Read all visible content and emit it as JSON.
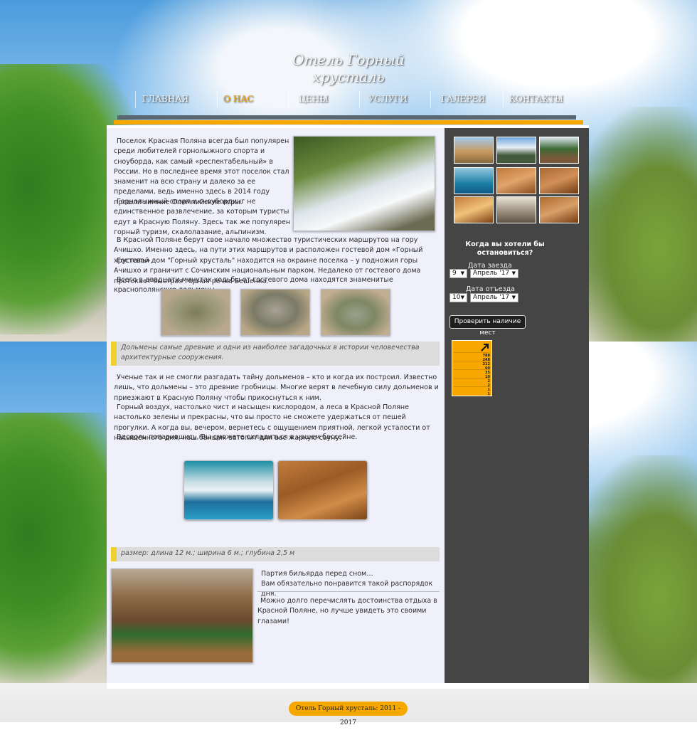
{
  "site": {
    "logo_text": "Отель Горный хрусталь"
  },
  "nav": {
    "items": [
      {
        "label": "ГЛАВНАЯ"
      },
      {
        "label": "О НАС"
      },
      {
        "label": "ЦЕНЫ"
      },
      {
        "label": "УСЛУГИ"
      },
      {
        "label": "ГАЛЕРЕЯ"
      },
      {
        "label": "КОНТАКТЫ"
      }
    ],
    "active_index": 1
  },
  "main": {
    "intro": [
      "Поселок Красная Поляна всегда был популярен среди любителей горнолыжного спорта и сноуборда, как самый «респектабельный» в России. Но в последнее время этот поселок стал знаменит на всю страну и далеко за ее пределами, ведь именно здесь в 2014 году прошли зимние Олимпийские игры.",
      "Горнолыжный спорт и сноубординг не единственное развлечение, за которым туристы едут в Красную Поляну. Здесь так же популярен горный туризм, скалолазание, альпинизм.",
      "В Красной Поляне берут свое начало множество туристических маршрутов на гору Ачишхо. Именно здесь, на пути этих маршрутов и расположен гостевой дом «Горный хрусталь».",
      "Гостевой дом \"Горный хрусталь\" находится на окраине поселка – у подножия горы Ачишхо и граничит с Сочинским национальным парком. Недалеко от гостевого дома протекает быстрая горная речка Бешенка.",
      "Всего в двадцати минутах ходьбы от гостевого дома находятся знаменитые краснополянские дольмены."
    ],
    "quote1": "Дольмены самые древние и одни из наиболее загадочных в истории человечества архитектурные сооружения.",
    "section2": [
      "Ученые так и не смогли разгадать тайну дольменов – кто и когда их построил. Известно лишь, что дольмены – это древние гробницы. Многие верят в лечебную силу дольменов и приезжают в Красную Поляну чтобы прикоснуться к ним.",
      "Горный воздух, настолько чист и насыщен кислородом, а леса в Красной Поляне настолько зелены и прекрасны, что вы просто не сможете удержаться от пешей прогулки. А когда вы, вечером, вернетесь с ощущением приятной, легкой усталости от насыщенного дня, наш банщик затопит для вас жаркую сауну.",
      "Вдоволь попарившись, Вы сможете охладиться в нашем бассейне."
    ],
    "quote2": "размер: длина 12 м.; ширина 6 м.; глубина 2,5 м",
    "billiard_caption": [
      "Партия бильярда перед сном…",
      "Вам обязательно понравится такой распорядок дня."
    ],
    "closing": "Можно долго перечислять достоинства отдыха в Красной Поляне, но лучше увидеть это своими глазами!"
  },
  "booking": {
    "title": "Когда вы хотели бы остановиться?",
    "checkin_label": "Дата заезда",
    "checkin_day": "9",
    "checkin_month": "Апрель '17",
    "checkout_label": "Дата отъезда",
    "checkout_day": "10",
    "checkout_month": "Апрель '17",
    "check_button": "Проверить наличие мест"
  },
  "counter": {
    "rows": [
      {
        "label": "",
        "value": "788\n248"
      },
      {
        "label": "",
        "value": "212\n60"
      },
      {
        "label": "",
        "value": "35\n10"
      },
      {
        "label": "",
        "value": "2\n2"
      },
      {
        "label": "",
        "value": "1\n1"
      }
    ]
  },
  "footer": {
    "text": "Отель Горный хрусталь: 2011 - 2017"
  },
  "colors": {
    "accent": "#f6a800",
    "quote_bar": "#f0d02c",
    "main_bg": "#f0f0fb",
    "sidebar_bg": "#1c1c1c"
  }
}
